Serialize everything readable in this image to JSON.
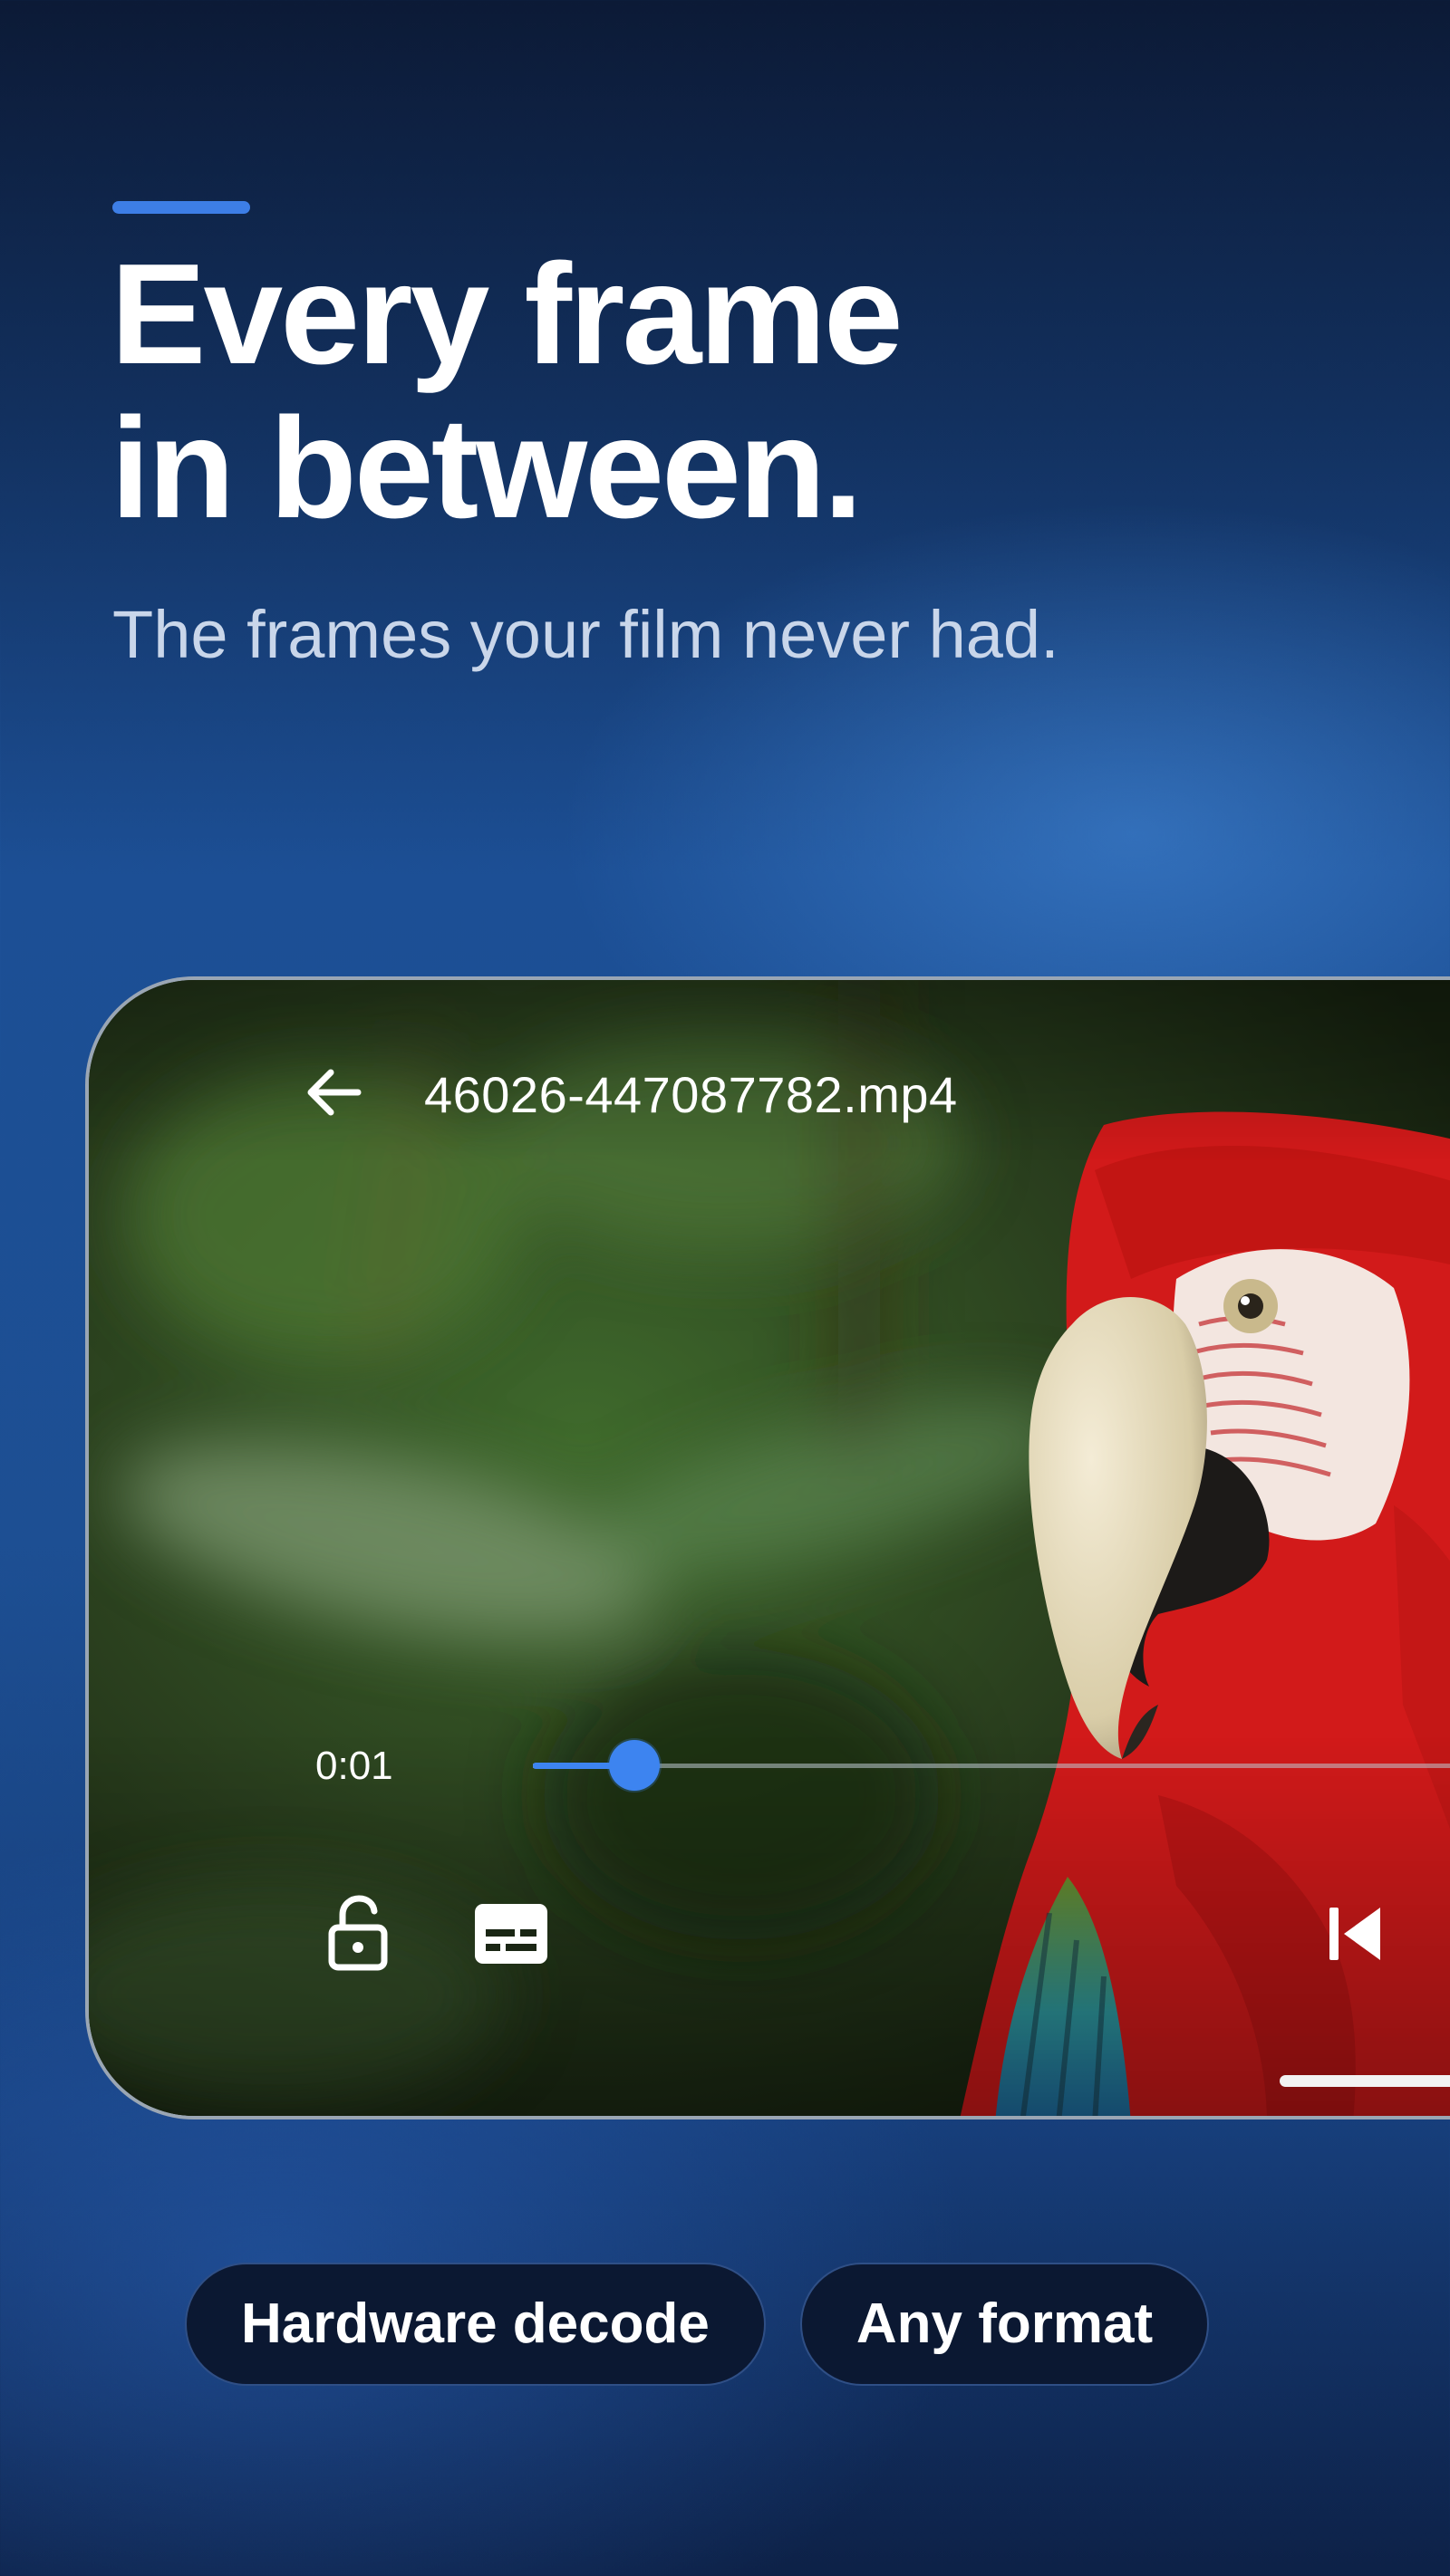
{
  "hero": {
    "headline_line1": "Every frame",
    "headline_line2": "in between.",
    "subtitle": "The frames your film never had."
  },
  "player": {
    "file_name": "46026-447087782.mp4",
    "elapsed_time": "0:01",
    "seek_progress": 0.105,
    "accent_color": "#3d84f0",
    "controls": {
      "back_icon": "arrow-left-icon",
      "lock_icon": "lock-open-icon",
      "subtitles_icon": "subtitles-icon",
      "previous_icon": "skip-previous-icon"
    }
  },
  "features": [
    {
      "label": "Hardware decode"
    },
    {
      "label": "Any format"
    }
  ],
  "theme": {
    "background_top": "#0c1a36",
    "background_mid": "#1d4f93",
    "chip_background": "#0b1832"
  }
}
